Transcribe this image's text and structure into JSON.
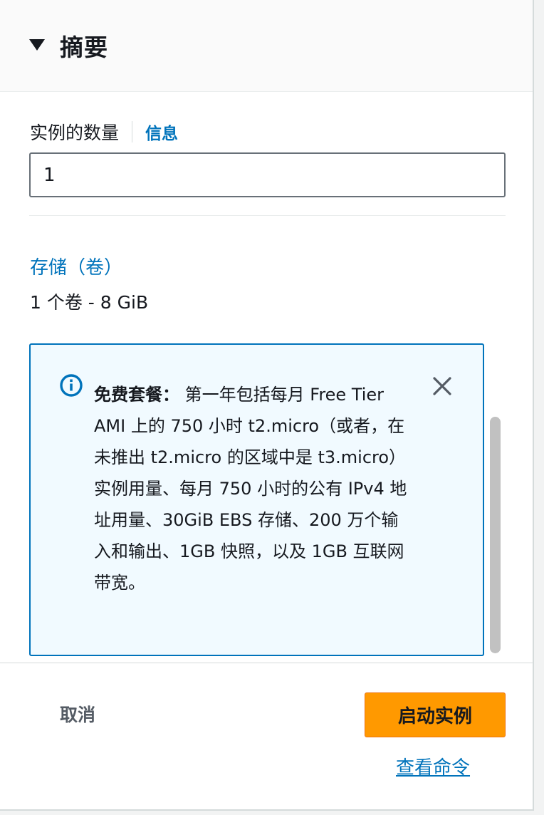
{
  "summary": {
    "title": "摘要"
  },
  "instance_count": {
    "label": "实例的数量",
    "info_link": "信息",
    "value": "1"
  },
  "storage": {
    "link": "存储（卷）",
    "value": "1 个卷 - 8 GiB"
  },
  "free_tier_alert": {
    "heading": "免费套餐：",
    "body": " 第一年包括每月 Free Tier AMI 上的 750 小时 t2.micro（或者，在未推出 t2.micro 的区域中是 t3.micro）实例用量、每月 750 小时的公有 IPv4 地址用量、30GiB EBS 存储、200 万个输入和输出、1GB 快照，以及 1GB 互联网带宽。"
  },
  "footer": {
    "cancel_label": "取消",
    "launch_label": "启动实例",
    "view_commands_label": "查看命令"
  },
  "colors": {
    "accent_link": "#0073bb",
    "primary_button": "#ff9900",
    "alert_background": "#f1faff",
    "alert_border": "#0073bb"
  },
  "icons": {
    "header": "caret-down-icon",
    "alert": "info-circle-icon",
    "dismiss": "close-icon"
  }
}
